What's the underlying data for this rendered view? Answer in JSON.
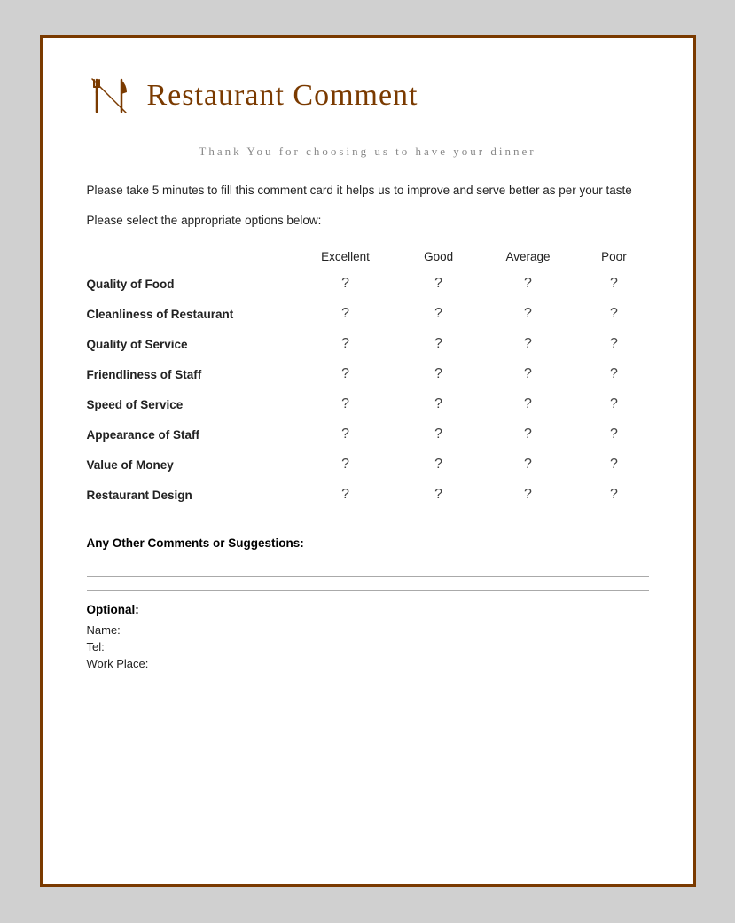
{
  "header": {
    "title": "Restaurant Comment",
    "icon": "🍴"
  },
  "thank_you": "Thank You for choosing us to have your\ndinner",
  "description": "Please take 5 minutes to fill this comment card it helps us to improve and serve better as per your taste",
  "instructions": "Please select the appropriate options below:",
  "table": {
    "columns": [
      "",
      "Excellent",
      "Good",
      "Average",
      "Poor"
    ],
    "rows": [
      {
        "label": "Quality of Food",
        "excellent": "?",
        "good": "?",
        "average": "?",
        "poor": "?"
      },
      {
        "label": "Cleanliness of Restaurant",
        "excellent": "?",
        "good": "?",
        "average": "?",
        "poor": "?"
      },
      {
        "label": "Quality of Service",
        "excellent": "?",
        "good": "?",
        "average": "?",
        "poor": "?"
      },
      {
        "label": "Friendliness of Staff",
        "excellent": "?",
        "good": "?",
        "average": "?",
        "poor": "?"
      },
      {
        "label": "Speed of Service",
        "excellent": "?",
        "good": "?",
        "average": "?",
        "poor": "?"
      },
      {
        "label": "Appearance of Staff",
        "excellent": "?",
        "good": "?",
        "average": "?",
        "poor": "?"
      },
      {
        "label": "Value of Money",
        "excellent": "?",
        "good": "?",
        "average": "?",
        "poor": "?"
      },
      {
        "label": "Restaurant Design",
        "excellent": "?",
        "good": "?",
        "average": "?",
        "poor": "?"
      }
    ]
  },
  "comments": {
    "label": "Any Other Comments or Suggestions:"
  },
  "optional": {
    "title": "Optional:",
    "fields": [
      "Name:",
      "Tel:",
      "Work Place:"
    ]
  },
  "colors": {
    "brand": "#7a3a00",
    "text": "#222222",
    "muted": "#888888"
  }
}
